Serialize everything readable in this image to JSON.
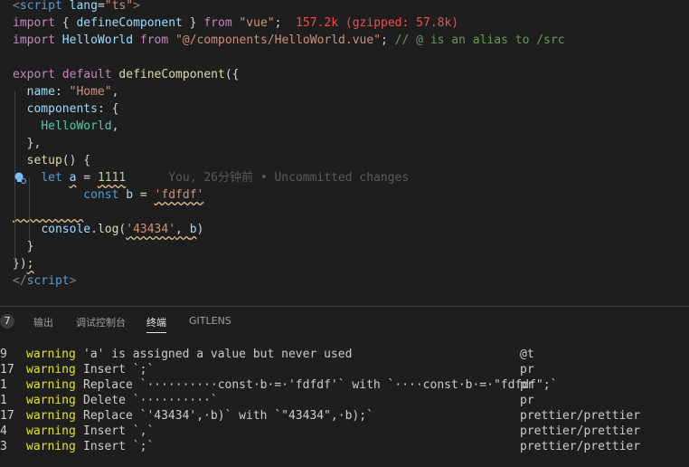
{
  "editor": {
    "lines": [
      {
        "tokens": [
          {
            "t": "<",
            "c": "tag"
          },
          {
            "t": "script",
            "c": "tagname"
          },
          {
            "t": " ",
            "c": ""
          },
          {
            "t": "lang",
            "c": "attr"
          },
          {
            "t": "=",
            "c": ""
          },
          {
            "t": "\"ts\"",
            "c": "str"
          },
          {
            "t": ">",
            "c": "tag"
          }
        ]
      },
      {
        "tokens": [
          {
            "t": "import",
            "c": "kw"
          },
          {
            "t": " { ",
            "c": ""
          },
          {
            "t": "defineComponent",
            "c": "prop"
          },
          {
            "t": " } ",
            "c": ""
          },
          {
            "t": "from",
            "c": "kw"
          },
          {
            "t": " ",
            "c": ""
          },
          {
            "t": "\"vue\"",
            "c": "str"
          },
          {
            "t": ";  ",
            "c": ""
          },
          {
            "t": "157.2k (gzipped: 57.8k)",
            "c": "size"
          }
        ]
      },
      {
        "tokens": [
          {
            "t": "import",
            "c": "kw"
          },
          {
            "t": " ",
            "c": ""
          },
          {
            "t": "HelloWorld",
            "c": "prop"
          },
          {
            "t": " ",
            "c": ""
          },
          {
            "t": "from",
            "c": "kw"
          },
          {
            "t": " ",
            "c": ""
          },
          {
            "t": "\"@/components/HelloWorld.vue\"",
            "c": "str"
          },
          {
            "t": "; ",
            "c": ""
          },
          {
            "t": "// @ is an alias to /src",
            "c": "cmt"
          }
        ]
      },
      {
        "tokens": []
      },
      {
        "tokens": [
          {
            "t": "export",
            "c": "kw"
          },
          {
            "t": " ",
            "c": ""
          },
          {
            "t": "default",
            "c": "kw"
          },
          {
            "t": " ",
            "c": ""
          },
          {
            "t": "defineComponent",
            "c": "fn"
          },
          {
            "t": "({",
            "c": ""
          }
        ]
      },
      {
        "tokens": [
          {
            "t": "  ",
            "c": ""
          },
          {
            "t": "name",
            "c": "prop"
          },
          {
            "t": ": ",
            "c": ""
          },
          {
            "t": "\"Home\"",
            "c": "str"
          },
          {
            "t": ",",
            "c": ""
          }
        ]
      },
      {
        "tokens": [
          {
            "t": "  ",
            "c": ""
          },
          {
            "t": "components",
            "c": "prop"
          },
          {
            "t": ": {",
            "c": ""
          }
        ]
      },
      {
        "tokens": [
          {
            "t": "    ",
            "c": ""
          },
          {
            "t": "HelloWorld",
            "c": "cls"
          },
          {
            "t": ",",
            "c": ""
          }
        ]
      },
      {
        "tokens": [
          {
            "t": "  },",
            "c": ""
          }
        ]
      },
      {
        "tokens": [
          {
            "t": "  ",
            "c": ""
          },
          {
            "t": "setup",
            "c": "fn"
          },
          {
            "t": "() {",
            "c": ""
          }
        ]
      },
      {
        "tokens": [
          {
            "t": "    ",
            "c": ""
          },
          {
            "t": "let",
            "c": "kwb"
          },
          {
            "t": " ",
            "c": ""
          },
          {
            "t": "a",
            "c": "prop squig"
          },
          {
            "t": " = ",
            "c": ""
          },
          {
            "t": "1111",
            "c": "num squig"
          },
          {
            "t": "      You, 26分钟前 • Uncommitted changes",
            "c": "blame"
          }
        ]
      },
      {
        "tokens": [
          {
            "t": "          ",
            "c": ""
          },
          {
            "t": "const",
            "c": "kwb"
          },
          {
            "t": " ",
            "c": ""
          },
          {
            "t": "b",
            "c": "prop"
          },
          {
            "t": " = ",
            "c": ""
          },
          {
            "t": "'fdfdf'",
            "c": "str squig"
          }
        ]
      },
      {
        "tokens": [
          {
            "t": "          ",
            "c": "squig"
          }
        ]
      },
      {
        "tokens": [
          {
            "t": "    ",
            "c": ""
          },
          {
            "t": "console",
            "c": "prop"
          },
          {
            "t": ".",
            "c": ""
          },
          {
            "t": "log",
            "c": "fn"
          },
          {
            "t": "(",
            "c": ""
          },
          {
            "t": "'43434'",
            "c": "str squig"
          },
          {
            "t": ", ",
            "c": "squig"
          },
          {
            "t": "b",
            "c": "prop squig"
          },
          {
            "t": ")",
            "c": ""
          }
        ]
      },
      {
        "tokens": [
          {
            "t": "  }",
            "c": ""
          }
        ]
      },
      {
        "tokens": [
          {
            "t": "})",
            "c": ""
          },
          {
            "t": ";",
            "c": "squig"
          }
        ]
      },
      {
        "tokens": [
          {
            "t": "</",
            "c": "tag"
          },
          {
            "t": "script",
            "c": "tagname"
          },
          {
            "t": ">",
            "c": "tag"
          }
        ]
      }
    ]
  },
  "panel": {
    "badge": "7",
    "tabs": [
      {
        "label": "输出",
        "active": false
      },
      {
        "label": "调试控制台",
        "active": false
      },
      {
        "label": "终端",
        "active": true
      },
      {
        "label": "GITLENS",
        "active": false
      }
    ],
    "rows": [
      {
        "num": "9",
        "severity": "warning",
        "message": "'a' is assigned a value but never used",
        "rule": "@t"
      },
      {
        "num": "17",
        "severity": "warning",
        "message": "Insert `;`",
        "rule": "pr"
      },
      {
        "num": "1",
        "severity": "warning",
        "message": "Replace `··········const·b·=·'fdfdf'` with `····const·b·=·\"fdfdf\";`",
        "rule": "pr"
      },
      {
        "num": "1",
        "severity": "warning",
        "message": "Delete `··········`",
        "rule": "pr"
      },
      {
        "num": "17",
        "severity": "warning",
        "message": "Replace `'43434',·b)` with `\"43434\",·b);`",
        "rule": "prettier/prettier"
      },
      {
        "num": "4",
        "severity": "warning",
        "message": "Insert `,`",
        "rule": "prettier/prettier"
      },
      {
        "num": "3",
        "severity": "warning",
        "message": "Insert `;`",
        "rule": "prettier/prettier"
      }
    ]
  },
  "colors": {
    "background": "#1e1e1e",
    "warning": "#e5e510",
    "keyword": "#c586c0",
    "string": "#ce9178"
  }
}
